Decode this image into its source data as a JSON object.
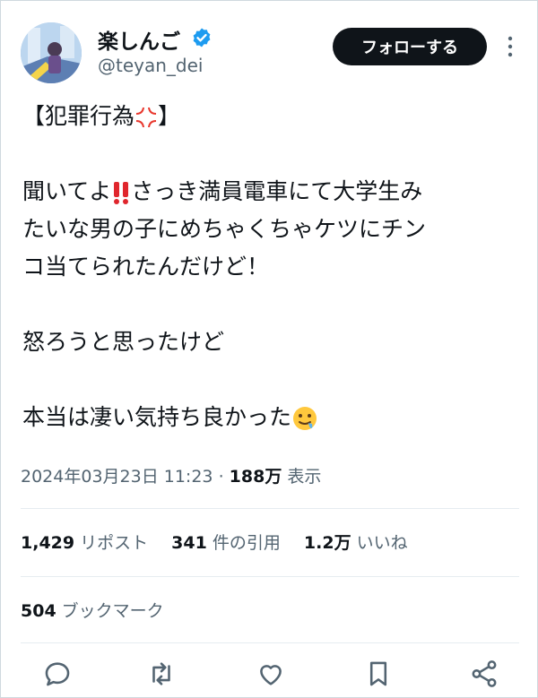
{
  "user": {
    "display_name": "楽しんご",
    "handle": "@teyan_dei",
    "verified": true
  },
  "follow_button": {
    "label": "フォローする"
  },
  "tweet": {
    "title": "【犯罪行為",
    "lines": [
      "聞いてよ",
      "さっき満員電車にて大学生み",
      "たいな男の子にめちゃくちゃケツにチン",
      "コ当てられたんだけど！",
      "怒ろうと思ったけど",
      "本当は凄い気持ち良かった"
    ],
    "emojis": {
      "title_emoji": "anger-symbol",
      "exclamation_emoji": "double-exclamation",
      "end_emoji": "drooling-face"
    }
  },
  "meta": {
    "timestamp": "2024年03月23日 11:23",
    "separator": "·",
    "views_count": "188万",
    "views_label": "表示"
  },
  "stats": {
    "reposts_count": "1,429",
    "reposts_label": "リポスト",
    "quotes_count": "341",
    "quotes_label": "件の引用",
    "likes_count": "1.2万",
    "likes_label": "いいね",
    "bookmarks_count": "504",
    "bookmarks_label": "ブックマーク"
  },
  "colors": {
    "text": "#0f1419",
    "muted": "#536471",
    "verified_blue": "#1d9bf0",
    "button_bg": "#0f1419"
  },
  "actions": [
    "reply-icon",
    "repost-icon",
    "like-icon",
    "bookmark-icon",
    "share-icon"
  ]
}
